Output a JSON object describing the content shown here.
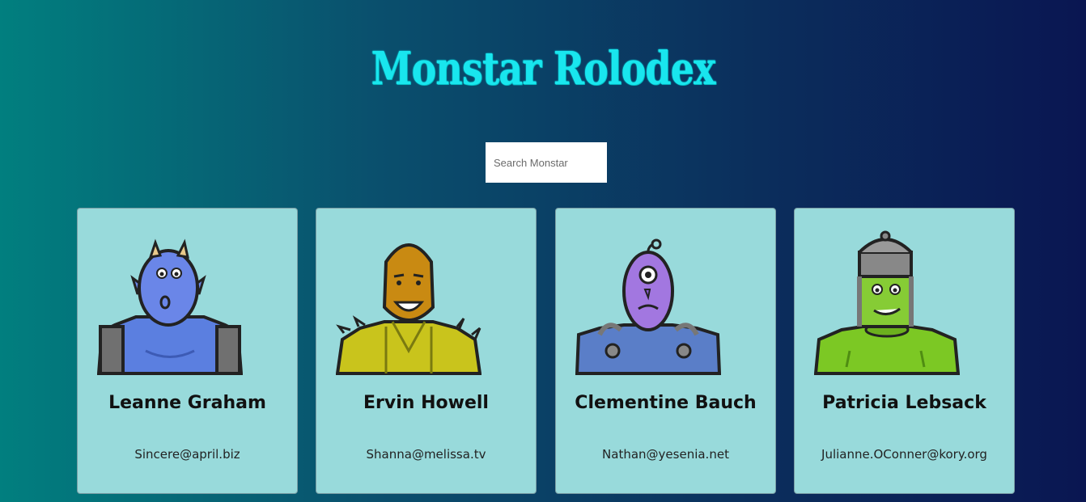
{
  "app": {
    "title": "Monstar Rolodex"
  },
  "search": {
    "placeholder": "Search Monstar",
    "value": ""
  },
  "monsters": [
    {
      "name": "Leanne Graham",
      "email": "Sincere@april.biz",
      "icon": "blue-horned-monster-avatar",
      "color": "#6a86e8"
    },
    {
      "name": "Ervin Howell",
      "email": "Shanna@melissa.tv",
      "icon": "orange-spiky-monster-avatar",
      "color": "#d7a21a"
    },
    {
      "name": "Clementine Bauch",
      "email": "Nathan@yesenia.net",
      "icon": "purple-cyclops-robot-avatar",
      "color": "#a277e0"
    },
    {
      "name": "Patricia Lebsack",
      "email": "Julianne.OConner@kory.org",
      "icon": "green-helmet-monster-avatar",
      "color": "#7cc824"
    }
  ],
  "colors": {
    "title": "#19e6ee",
    "card_background": "#98dadb"
  }
}
